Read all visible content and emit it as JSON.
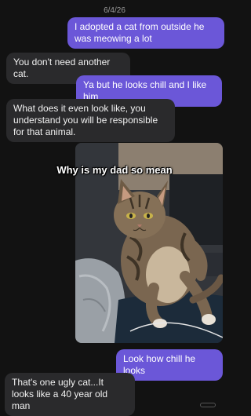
{
  "conversation": {
    "date": "6/4/26",
    "messages": [
      {
        "sender": "me",
        "text": "I adopted a cat from outside he was meowing a lot"
      },
      {
        "sender": "dad",
        "text": "You don't need another cat."
      },
      {
        "sender": "me",
        "text": "Ya but he looks chill and I like him"
      },
      {
        "sender": "dad",
        "text": "What does it even look like, you understand you will be responsible for that animal."
      },
      {
        "sender": "me",
        "text": "Look how chill he looks"
      },
      {
        "sender": "dad",
        "text": "That's one ugly cat...It looks like a 40 year old man"
      }
    ]
  },
  "overlay": {
    "caption": "Why is my dad so mean"
  },
  "colors": {
    "background": "#121212",
    "outgoing_bubble": "#6b57d8",
    "incoming_bubble": "#2a2a2c"
  }
}
